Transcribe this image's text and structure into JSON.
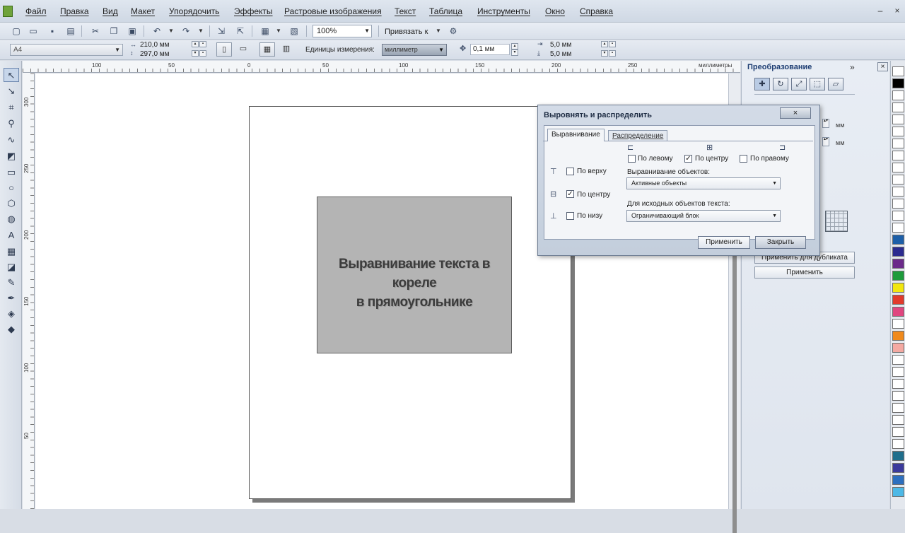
{
  "menu": {
    "items": [
      "Файл",
      "Правка",
      "Вид",
      "Макет",
      "Упорядочить",
      "Эффекты",
      "Растровые изображения",
      "Текст",
      "Таблица",
      "Инструменты",
      "Окно",
      "Справка"
    ]
  },
  "toolbar": {
    "zoom": "100%",
    "snap_label": "Привязать к"
  },
  "property_bar": {
    "page_size": "A4",
    "width": "210,0 мм",
    "height": "297,0 мм",
    "units_label": "Единицы измерения:",
    "units_value": "миллиметр",
    "nudge": "0,1 мм",
    "dup_x": "5,0 мм",
    "dup_y": "5,0 мм"
  },
  "ruler": {
    "units_label": "миллиметры",
    "top_labels": [
      "100",
      "50",
      "0",
      "50",
      "100",
      "150",
      "200",
      "250"
    ],
    "left_labels": [
      "300",
      "250",
      "200",
      "150",
      "100",
      "50"
    ]
  },
  "canvas": {
    "rect_text_line1": "Выравнивание текста в кореле",
    "rect_text_line2": "в прямоугольнике"
  },
  "docker": {
    "title": "Преобразование",
    "mm1": "мм",
    "mm2": "мм",
    "apply_duplicate_label": "Применить для дубликата",
    "apply_label": "Применить"
  },
  "dialog": {
    "title": "Выровнять и распределить",
    "close_label": "×",
    "tab_align": "Выравнивание",
    "tab_distribute": "Распределение",
    "h_left": "По левому",
    "h_center": "По центру",
    "h_right": "По правому",
    "v_top": "По верху",
    "v_center": "По центру",
    "v_bottom": "По низу",
    "align_objects_label": "Выравнивание объектов:",
    "align_objects_value": "Активные объекты",
    "text_source_label": "Для исходных объектов текста:",
    "text_source_value": "Ограничивающий блок",
    "apply_button": "Применить",
    "close_button": "Закрыть",
    "checked_h_center": true,
    "checked_v_center": true
  },
  "palette": {
    "colors": [
      "#ffffff",
      "#000000",
      "#ffffff",
      "#ffffff",
      "#ffffff",
      "#ffffff",
      "#ffffff",
      "#ffffff",
      "#ffffff",
      "#ffffff",
      "#ffffff",
      "#ffffff",
      "#ffffff",
      "#ffffff",
      "#1d5fa8",
      "#2b2b8f",
      "#6b2a8a",
      "#1d9b3b",
      "#f2e60f",
      "#e23a2c",
      "#e0467f",
      "#ffffff",
      "#f08a1c",
      "#f4a9a2",
      "#ffffff",
      "#ffffff",
      "#ffffff",
      "#ffffff",
      "#ffffff",
      "#ffffff",
      "#ffffff",
      "#ffffff",
      "#1f6e8c",
      "#3a3a9c",
      "#2c6fbf",
      "#4cb8e6"
    ]
  }
}
